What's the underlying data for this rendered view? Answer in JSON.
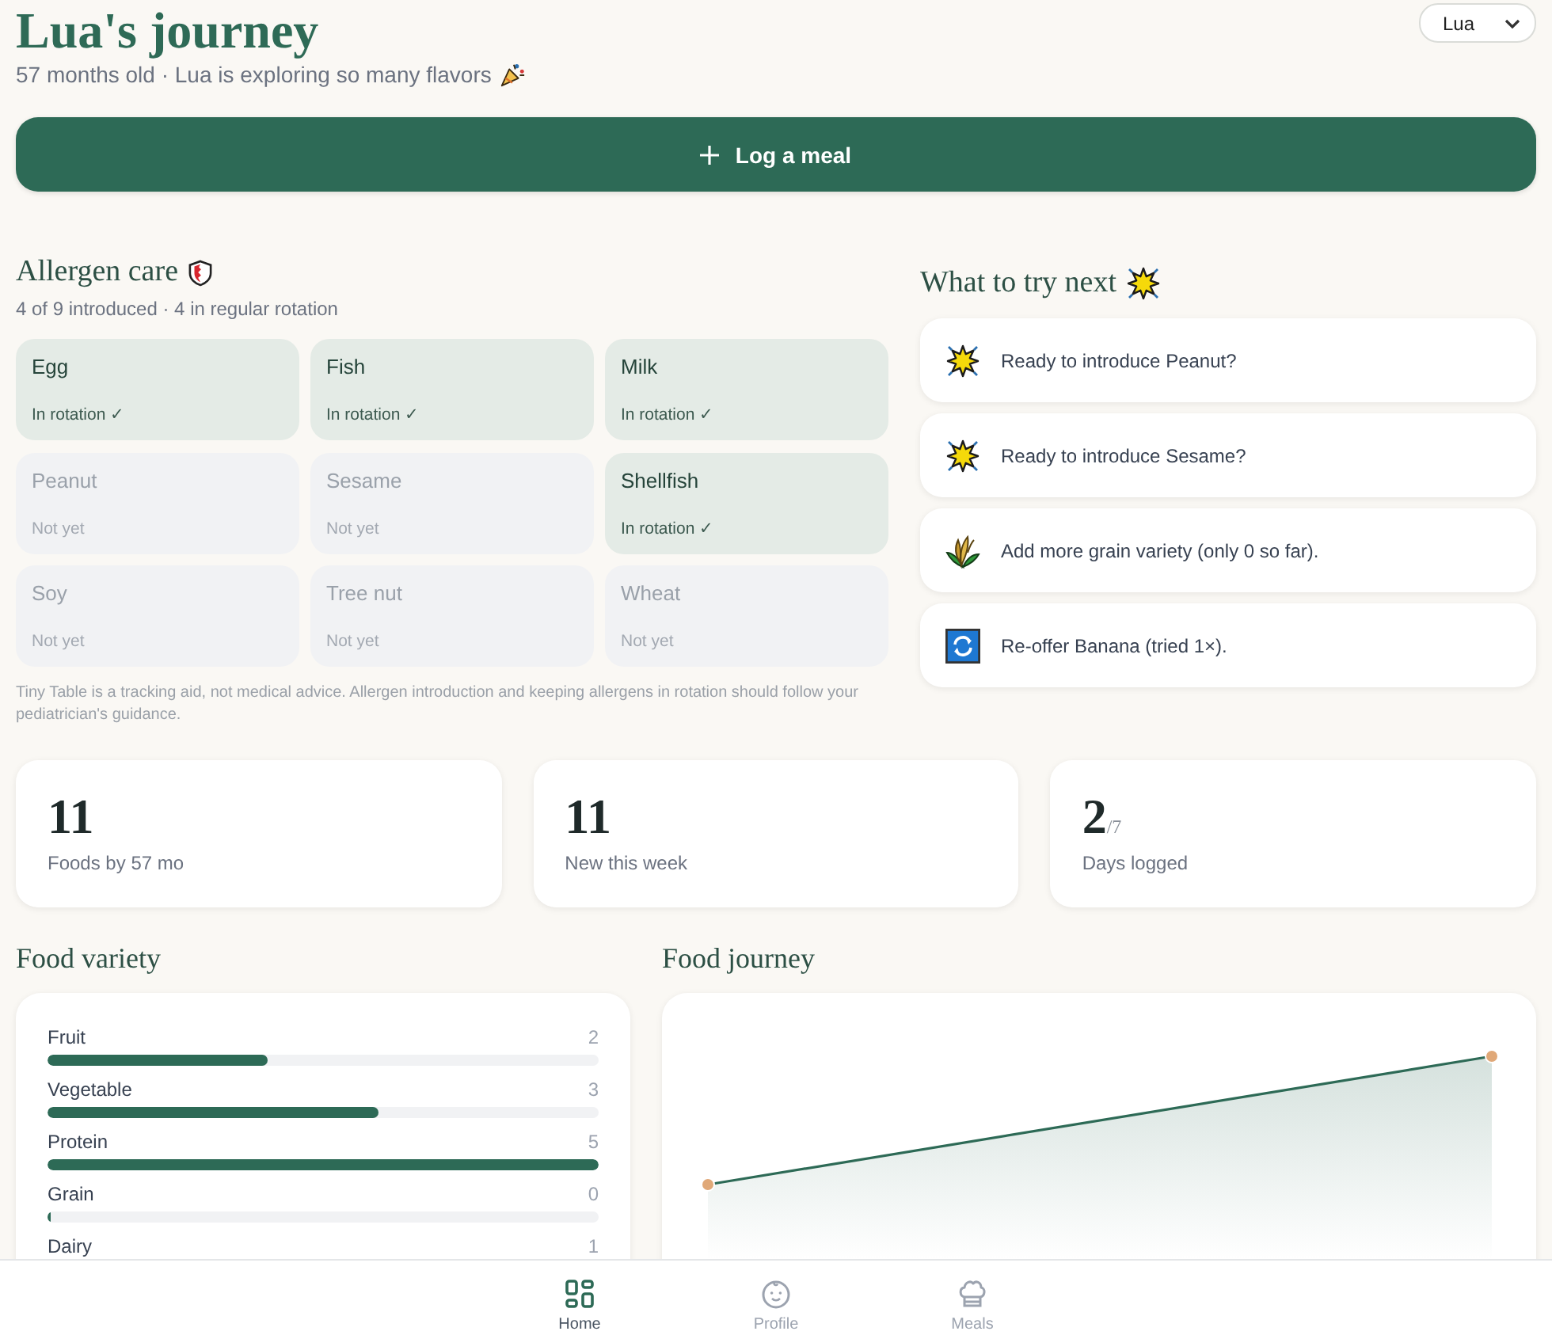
{
  "header": {
    "title": "Lua's journey",
    "subtitle": "57 months old · Lua is exploring so many flavors",
    "child_select": {
      "value": "Lua"
    }
  },
  "log_button": {
    "label": "Log a meal"
  },
  "allergen_care": {
    "title": "Allergen care",
    "summary": "4 of 9 introduced · 4 in regular rotation",
    "allergens": [
      {
        "name": "Egg",
        "status": "In rotation ✓",
        "introduced": true
      },
      {
        "name": "Fish",
        "status": "In rotation ✓",
        "introduced": true
      },
      {
        "name": "Milk",
        "status": "In rotation ✓",
        "introduced": true
      },
      {
        "name": "Peanut",
        "status": "Not yet",
        "introduced": false
      },
      {
        "name": "Sesame",
        "status": "Not yet",
        "introduced": false
      },
      {
        "name": "Shellfish",
        "status": "In rotation ✓",
        "introduced": true
      },
      {
        "name": "Soy",
        "status": "Not yet",
        "introduced": false
      },
      {
        "name": "Tree nut",
        "status": "Not yet",
        "introduced": false
      },
      {
        "name": "Wheat",
        "status": "Not yet",
        "introduced": false
      }
    ],
    "disclaimer": "Tiny Table is a tracking aid, not medical advice. Allergen introduction and keeping allergens in rotation should follow your pediatrician's guidance."
  },
  "try_next": {
    "title": "What to try next",
    "suggestions": [
      {
        "kind": "star",
        "text": "Ready to introduce Peanut?"
      },
      {
        "kind": "star",
        "text": "Ready to introduce Sesame?"
      },
      {
        "kind": "grain",
        "text": "Add more grain variety (only 0 so far)."
      },
      {
        "kind": "refresh",
        "text": "Re-offer Banana (tried 1×)."
      }
    ]
  },
  "stats": [
    {
      "value": "11",
      "label": "Foods by 57 mo"
    },
    {
      "value": "11",
      "label": "New this week"
    },
    {
      "value": "2",
      "suffix": "/7",
      "label": "Days logged"
    }
  ],
  "food_variety": {
    "title": "Food variety",
    "categories": [
      {
        "name": "Fruit",
        "count": "2",
        "level": 0.4
      },
      {
        "name": "Vegetable",
        "count": "3",
        "level": 0.6
      },
      {
        "name": "Protein",
        "count": "5",
        "level": 1
      },
      {
        "name": "Grain",
        "count": "0",
        "level": 0
      },
      {
        "name": "Dairy",
        "count": "1"
      }
    ]
  },
  "food_journey": {
    "title": "Food journey"
  },
  "nav": [
    {
      "kind": "home",
      "label": "Home",
      "selected": true
    },
    {
      "kind": "profile",
      "label": "Profile",
      "selected": false
    },
    {
      "kind": "meals",
      "label": "Meals",
      "selected": false
    }
  ]
}
